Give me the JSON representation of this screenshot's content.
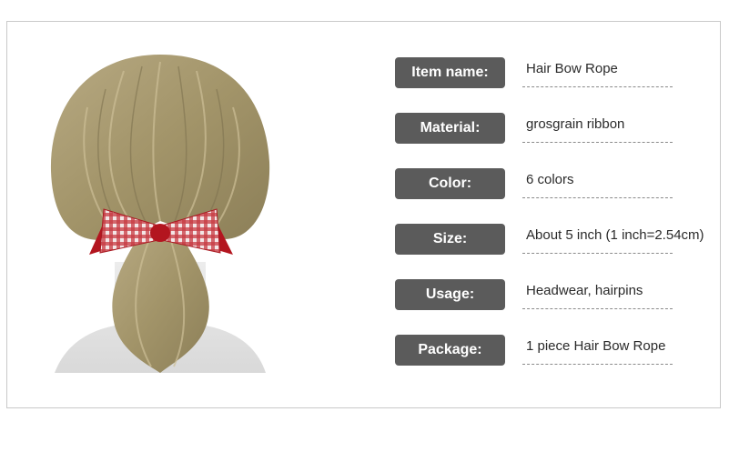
{
  "specs": [
    {
      "label": "Item name:",
      "value": "Hair Bow Rope"
    },
    {
      "label": "Material:",
      "value": "grosgrain ribbon"
    },
    {
      "label": "Color:",
      "value": "6 colors"
    },
    {
      "label": "Size:",
      "value": "About 5 inch (1 inch=2.54cm)"
    },
    {
      "label": "Usage:",
      "value": "Headwear, hairpins"
    },
    {
      "label": "Package:",
      "value": "1 piece Hair Bow Rope"
    }
  ],
  "colors": {
    "label_bg": "#5b5b5b",
    "bow_red": "#c0202a",
    "hair": "#a89a72"
  },
  "image": {
    "subject": "mannequin head with hair tied by red gingham bow"
  }
}
